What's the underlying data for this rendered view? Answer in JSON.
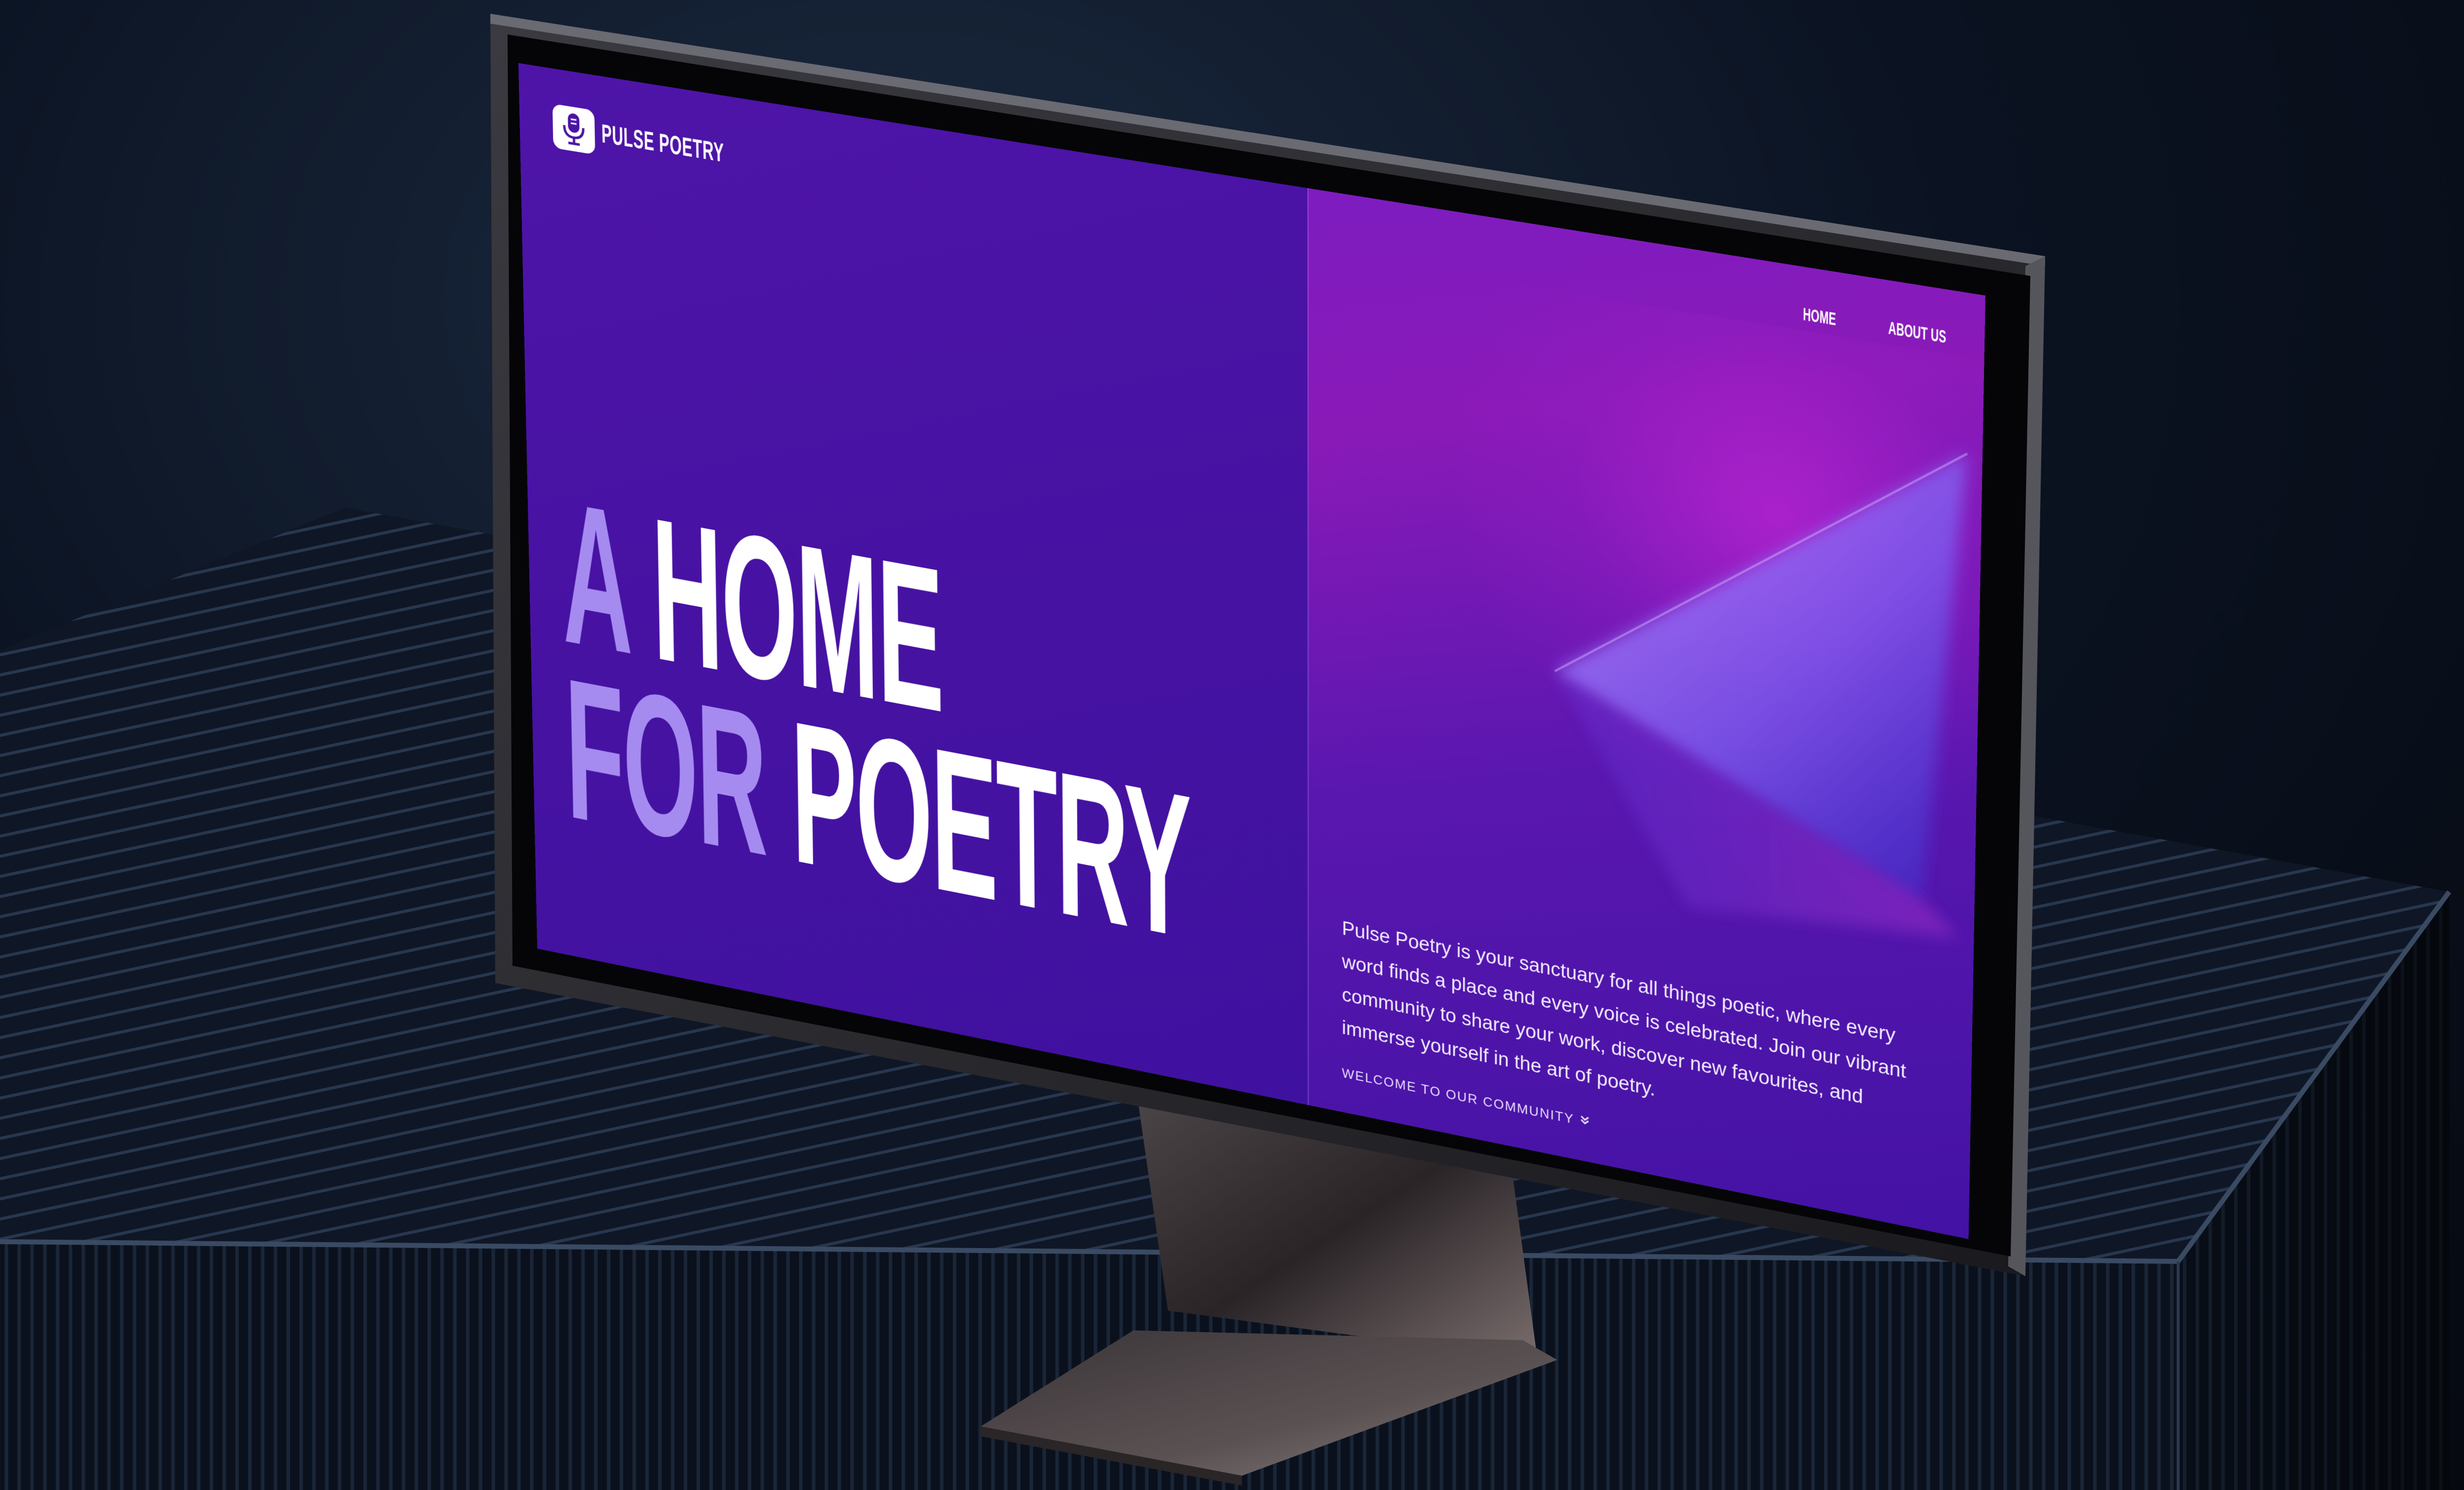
{
  "brand": {
    "name": "PULSE POETRY",
    "logo_icon": "microphone-icon"
  },
  "nav": {
    "items": [
      "HOME",
      "ABOUT US"
    ]
  },
  "hero": {
    "line1_muted": "A",
    "line1_bright": "HOME",
    "line2_muted": "FOR",
    "line2_bright": "POETRY"
  },
  "intro": {
    "text": "Pulse Poetry is your sanctuary for all things poetic, where every word finds a place and every voice is celebrated. Join our vibrant community to share your work, discover new favourites, and immerse yourself in the art of poetry.",
    "cta_label": "WELCOME TO OUR COMMUNITY",
    "cta_icon": "double-chevron-down-icon"
  },
  "colors": {
    "page_purple": "#4a14a3",
    "accent_magenta": "#8a1ab8",
    "muted_lavender": "#a58bf0",
    "text_white": "#ffffff"
  }
}
